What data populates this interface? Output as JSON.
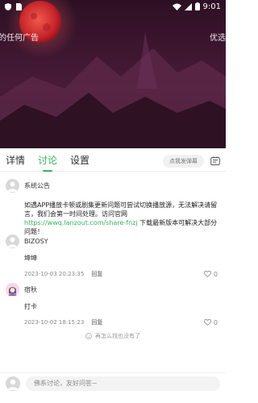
{
  "status_bar": {
    "time": "9:01",
    "left_icons": [
      "shield-icon",
      "sim-icon"
    ],
    "right_icons": [
      "wifi-icon",
      "signal-icon",
      "battery-icon"
    ]
  },
  "video": {
    "marquee_left": "的任何广告",
    "marquee_right": "优选"
  },
  "tabs": [
    {
      "label": "详情",
      "active": false
    },
    {
      "label": "讨论",
      "active": true
    },
    {
      "label": "设置",
      "active": false
    }
  ],
  "danmaku_button": "点我发弹幕",
  "accent_color": "#35b45e",
  "comments": [
    {
      "user": "系统公告",
      "text_before_link": "如遇APP播放卡顿或剧集更新问题可尝试切换播放源，无法解决请留言，我们会第一时间处理。访问官网 ",
      "link": "https://wwq.lanzout.com/share-fnzj",
      "text_after_link": " 下载最新版本可解决大部分问题！"
    },
    {
      "user": "BIZOSY",
      "text": "坤坤",
      "time": "2023-10-03 20:23:35",
      "reply": "回复",
      "likes": "0"
    },
    {
      "user": "宿秋",
      "text": "打卡",
      "time": "2023-10-02 18:15:23",
      "reply": "回复",
      "likes": "0"
    }
  ],
  "end_tip": "再怎么找也没有了",
  "input_placeholder": "佛系讨论，友好问答~"
}
